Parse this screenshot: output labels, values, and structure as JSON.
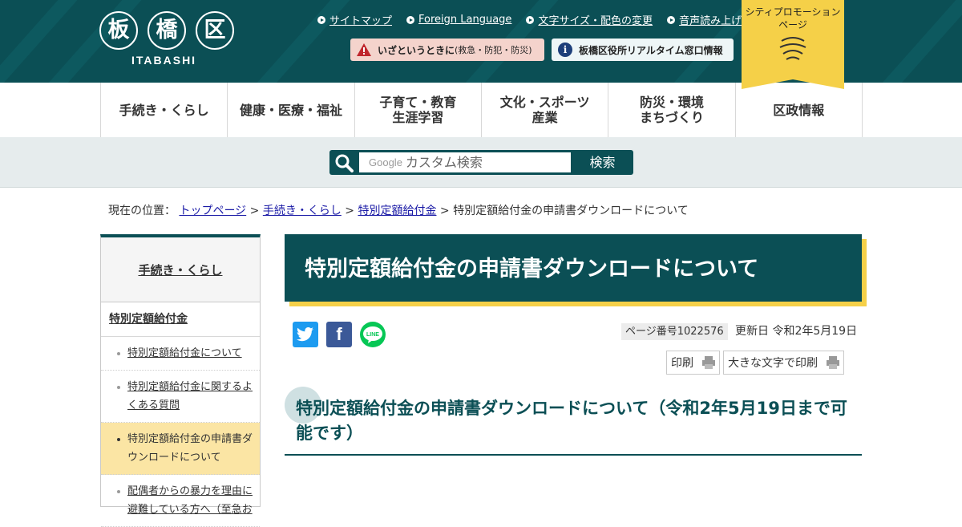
{
  "header": {
    "logo_kanji": [
      "板",
      "橋",
      "区"
    ],
    "logo_sub": "ITABASHI",
    "top_links": [
      "サイトマップ",
      "Foreign Language",
      "文字サイズ・配色の変更",
      "音声読み上げ"
    ],
    "alert_label": "いざというときに",
    "alert_sub": "(救急・防犯・防災)",
    "info_label": "板橋区役所リアルタイム窓口情報",
    "info_icon": "i",
    "promo_line1": "シティプロモーション",
    "promo_line2": "ページ"
  },
  "nav": [
    [
      "手続き・くらし"
    ],
    [
      "健康・医療・福祉"
    ],
    [
      "子育て・教育",
      "生涯学習"
    ],
    [
      "文化・スポーツ",
      "産業"
    ],
    [
      "防災・環境",
      "まちづくり"
    ],
    [
      "区政情報"
    ]
  ],
  "search": {
    "google_label": "Google",
    "placeholder": "カスタム検索",
    "button": "検索"
  },
  "breadcrumb": {
    "prefix": "現在の位置：",
    "links": [
      "トップページ",
      "手続き・くらし",
      "特別定額給付金"
    ],
    "sep": ">",
    "current": "特別定額給付金の申請書ダウンロードについて"
  },
  "sidebar": {
    "head": "手続き・くらし",
    "section": "特別定額給付金",
    "items": [
      "特別定額給付金について",
      "特別定額給付金に関するよくある質問",
      "特別定額給付金の申請書ダウンロードについて",
      "配偶者からの暴力を理由に避難している方へ（至急お"
    ]
  },
  "main": {
    "title": "特別定額給付金の申請書ダウンロードについて",
    "social": {
      "facebook": "f",
      "line": "LINE"
    },
    "page_no": "ページ番号1022576",
    "updated": "更新日 令和2年5月19日",
    "print": "印刷",
    "print_large": "大きな文字で印刷",
    "h2": "特別定額給付金の申請書ダウンロードについて（令和2年5月19日まで可能です）"
  },
  "colors": {
    "brand": "#0b4f55",
    "accent": "#f5d048",
    "active": "#fbe5a4"
  }
}
